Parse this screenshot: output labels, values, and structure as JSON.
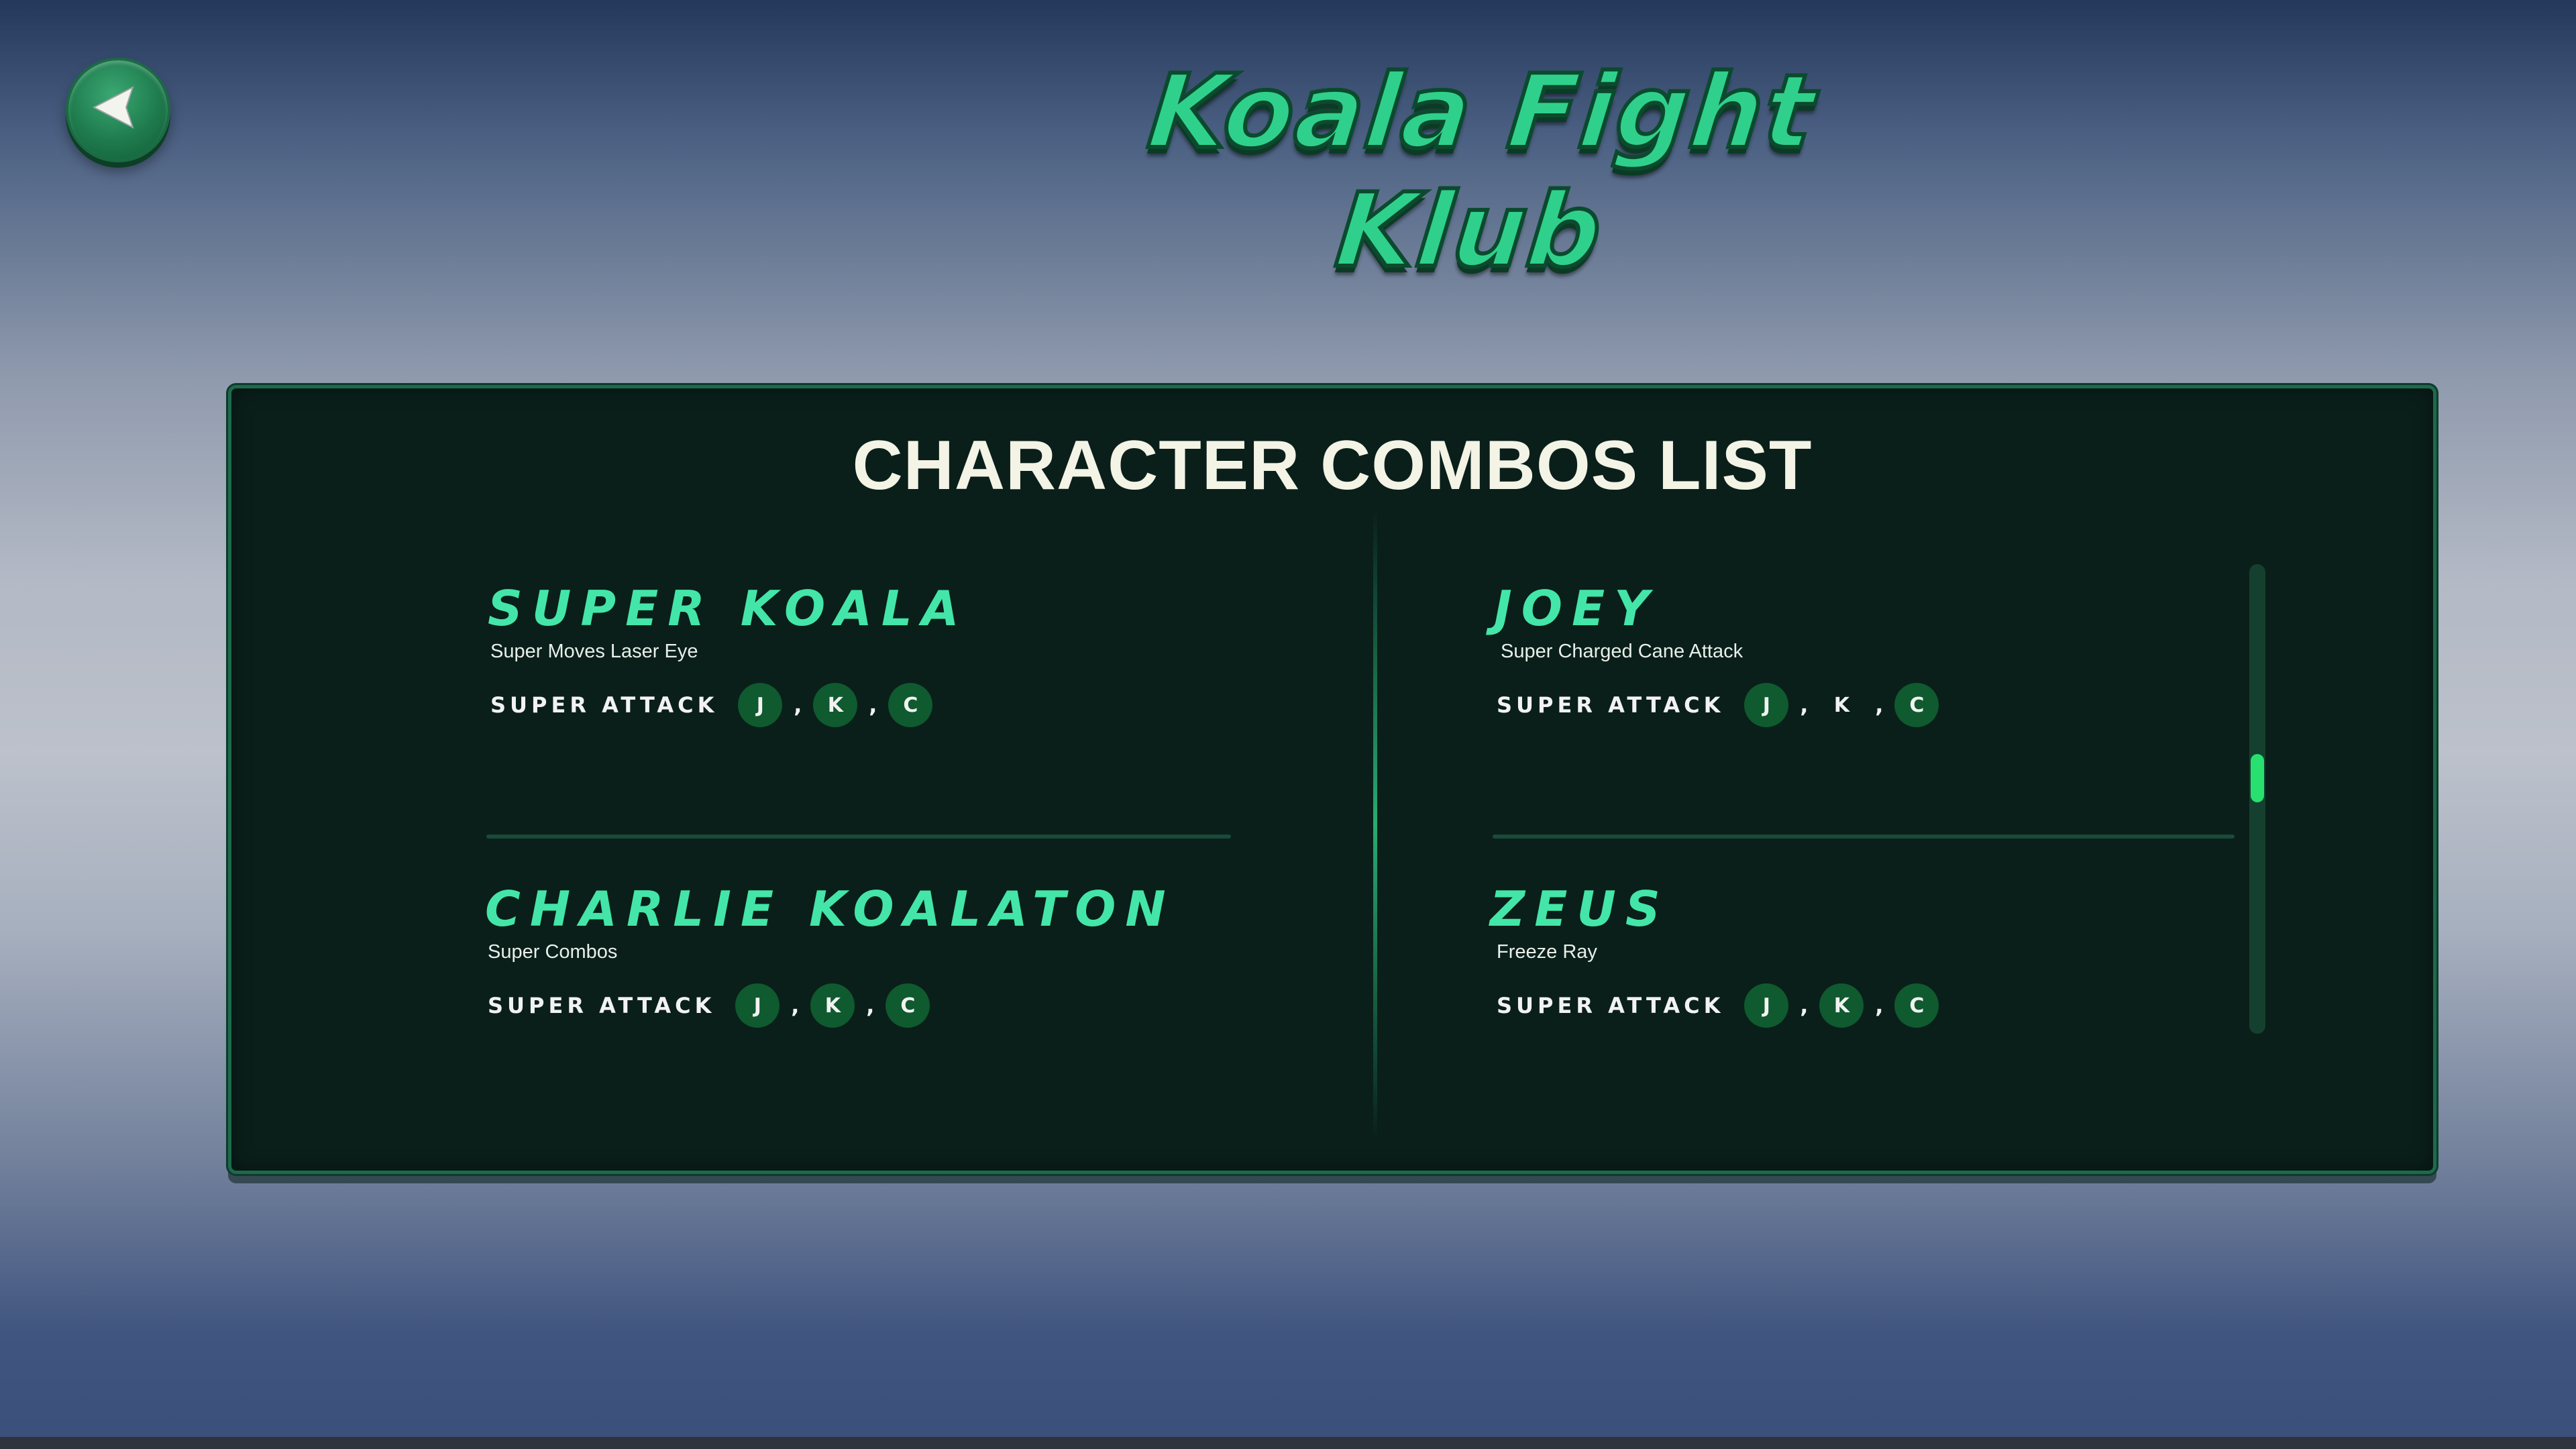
{
  "game": {
    "logo_text": "Koala Fight Klub"
  },
  "back_button": {
    "icon": "back-arrow-icon"
  },
  "panel": {
    "title": "CHARACTER COMBOS LIST",
    "characters": [
      {
        "name": "SUPER KOALA",
        "description": "Super Moves Laser Eye",
        "combo_label": "SUPER ATTACK",
        "keys": [
          "J",
          "K",
          "C"
        ],
        "separator": ","
      },
      {
        "name": "JOEY",
        "description": "Super Charged Cane Attack",
        "combo_label": "SUPER ATTACK",
        "keys": [
          "J",
          "K",
          "C"
        ],
        "separator": ","
      },
      {
        "name": "CHARLIE KOALATON",
        "description": "Super Combos",
        "combo_label": "SUPER ATTACK",
        "keys": [
          "J",
          "K",
          "C"
        ],
        "separator": ","
      },
      {
        "name": "ZEUS",
        "description": "Freeze Ray",
        "combo_label": "SUPER ATTACK",
        "keys": [
          "J",
          "K",
          "C"
        ],
        "separator": ","
      }
    ],
    "scroll_position": 0.45
  },
  "colors": {
    "accent": "#2fd08b",
    "character_name": "#43e6a8",
    "panel_bg": "#0a1f1a",
    "key_bg": "#0f5a2f",
    "scroll_thumb": "#27e06f"
  }
}
